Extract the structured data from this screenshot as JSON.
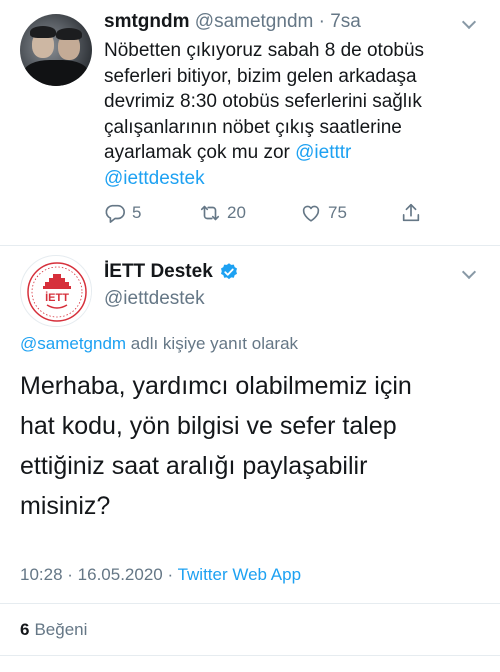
{
  "reply_tweet": {
    "author_name": "smtgndm",
    "author_handle": "@sametgndm",
    "separator": "·",
    "time_ago": "7sa",
    "text_lines": [
      "Nöbetten çıkıyoruz sabah 8 de otobüs",
      "seferleri bitiyor, bizim gelen arkadaşa",
      "devrimiz 8:30 otobüs seferlerini sağlık",
      "çalışanlarının nöbet çıkış saatlerine"
    ],
    "text_line5_prefix": "ayarlamak çok mu zor ",
    "mention_1": "@ietttr",
    "mention_2": "@iettdestek",
    "actions": {
      "reply_count": "5",
      "retweet_count": "20",
      "like_count": "75"
    }
  },
  "main_tweet": {
    "author_name": "İETT Destek",
    "author_handle": "@iettdestek",
    "logo_text": "İETT",
    "reply_to_handle": "@sametgndm",
    "reply_to_suffix": " adlı kişiye yanıt olarak",
    "text_lines": [
      "Merhaba, yardımcı olabilmemiz için",
      "hat kodu, yön bilgisi ve sefer talep",
      "ettiğiniz saat aralığı paylaşabilir",
      "misiniz?"
    ],
    "time": "10:28",
    "date": "16.05.2020",
    "meta_separator": " · ",
    "source": "Twitter Web App",
    "likes_count": "6",
    "likes_label": "Beğeni"
  },
  "colors": {
    "accent": "#1da1f2",
    "secondary_text": "#657786",
    "primary_text": "#14171a",
    "divider": "#e6ecf0",
    "logo_red": "#d6303b"
  },
  "icons": [
    "reply-icon",
    "retweet-icon",
    "like-icon",
    "share-icon",
    "chevron-down-icon",
    "verified-badge-icon"
  ]
}
